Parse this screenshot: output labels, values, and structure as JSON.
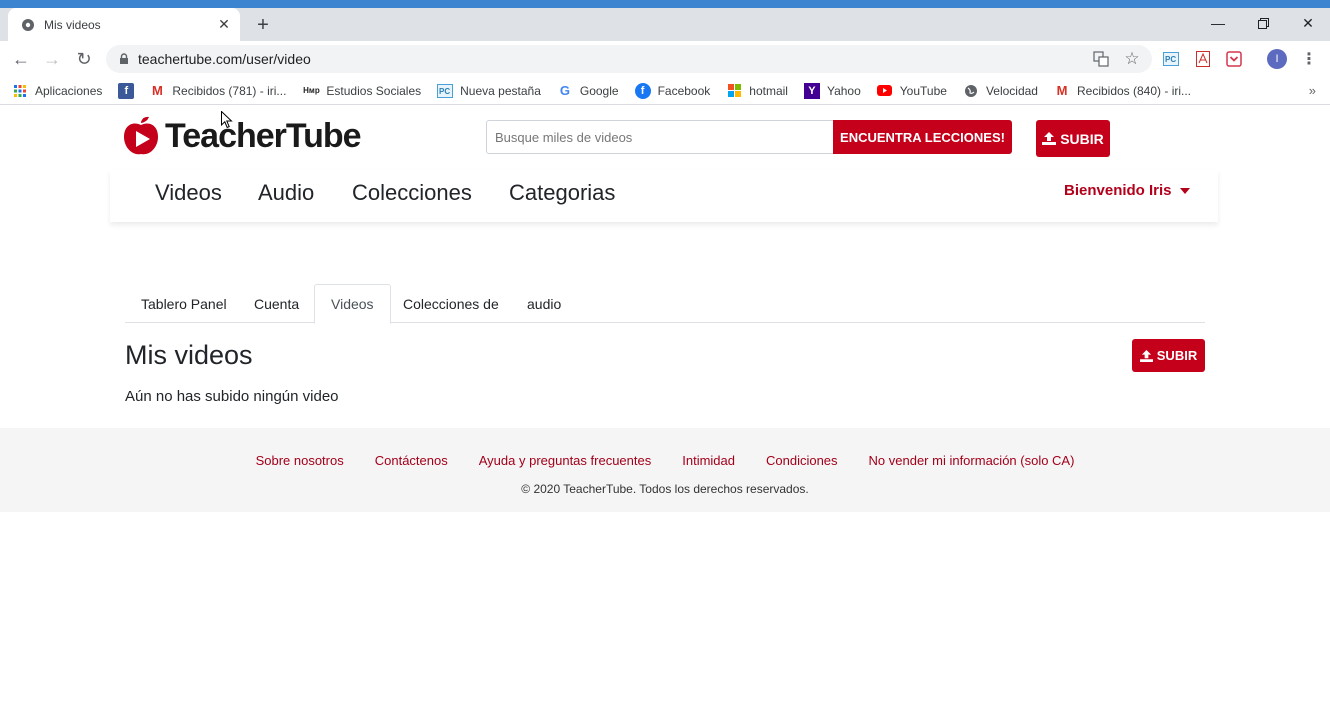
{
  "browser": {
    "tab_title": "Mis videos",
    "url": "teachertube.com/user/video",
    "bookmarks": [
      {
        "label": "Aplicaciones",
        "icon": "apps-grid-icon"
      },
      {
        "label": "",
        "icon": "facebook-icon"
      },
      {
        "label": "Recibidos (781) - iri...",
        "icon": "gmail-icon"
      },
      {
        "label": "Estudios Sociales",
        "icon": "hmp-icon"
      },
      {
        "label": "Nueva pestaña",
        "icon": "pc-icon"
      },
      {
        "label": "Google",
        "icon": "google-icon"
      },
      {
        "label": "Facebook",
        "icon": "facebook-icon"
      },
      {
        "label": "hotmail",
        "icon": "windows-icon"
      },
      {
        "label": "Yahoo",
        "icon": "yahoo-icon"
      },
      {
        "label": "YouTube",
        "icon": "youtube-icon"
      },
      {
        "label": "Velocidad",
        "icon": "globe-icon"
      },
      {
        "label": "Recibidos (840) - iri...",
        "icon": "gmail-icon"
      }
    ],
    "profile_initial": "I"
  },
  "site": {
    "logo_text": "TeacherTube",
    "search_placeholder": "Busque miles de videos",
    "find_button": "ENCUENTRA LECCIONES!",
    "upload_label": "SUBIR",
    "nav": [
      "Videos",
      "Audio",
      "Colecciones",
      "Categorias"
    ],
    "welcome": "Bienvenido Iris",
    "tabs": [
      "Tablero Panel",
      "Cuenta",
      "Videos",
      "Colecciones de",
      "audio"
    ],
    "active_tab": "Videos",
    "page_title": "Mis videos",
    "empty_message": "Aún no has subido ningún video",
    "footer_links": [
      "Sobre nosotros",
      "Contáctenos",
      "Ayuda y preguntas frecuentes",
      "Intimidad",
      "Condiciones",
      "No vender mi información (solo CA)"
    ],
    "copyright": "© 2020 TeacherTube. Todos los derechos reservados."
  },
  "colors": {
    "brand_red": "#c4001a",
    "link_red": "#a3001a",
    "chrome_blue": "#3d84d0"
  }
}
